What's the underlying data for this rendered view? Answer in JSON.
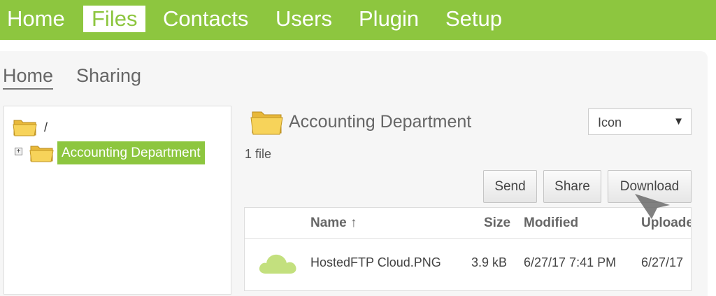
{
  "nav": {
    "items": [
      {
        "label": "Home"
      },
      {
        "label": "Files",
        "active": true
      },
      {
        "label": "Contacts"
      },
      {
        "label": "Users"
      },
      {
        "label": "Plugin"
      },
      {
        "label": "Setup"
      }
    ]
  },
  "subtabs": [
    {
      "label": "Home",
      "active": true
    },
    {
      "label": "Sharing"
    }
  ],
  "tree": {
    "root_label": "/",
    "selected_node": "Accounting Department",
    "expander": "+"
  },
  "folder": {
    "title": "Accounting Department",
    "file_count": "1 file"
  },
  "view_select": {
    "value": "Icon",
    "caret": "▼"
  },
  "actions": {
    "send": "Send",
    "share": "Share",
    "download": "Download"
  },
  "table": {
    "columns": [
      "Name ↑",
      "Size",
      "Modified",
      "Uploade"
    ],
    "rows": [
      {
        "name": "HostedFTP Cloud.PNG",
        "size": "3.9 kB",
        "modified": "6/27/17 7:41 PM",
        "uploaded": "6/27/17"
      }
    ]
  },
  "colors": {
    "accent": "#8dc63f",
    "folder": "#f7d35a"
  }
}
